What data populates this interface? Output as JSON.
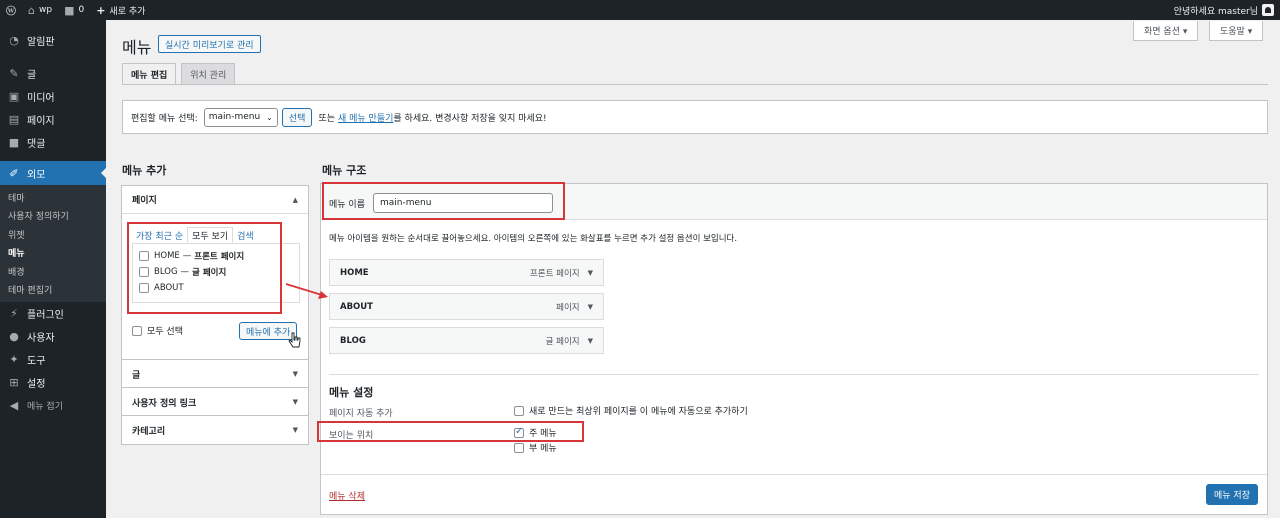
{
  "adminbar": {
    "site_name": "wp",
    "comments_count": "0",
    "new_label": "새로 추가",
    "greeting": "안녕하세요 master님"
  },
  "sidebar": {
    "items": [
      {
        "label": "알림판",
        "icon": "dashboard-icon"
      },
      {
        "label": "글",
        "icon": "pin-icon"
      },
      {
        "label": "미디어",
        "icon": "media-icon"
      },
      {
        "label": "페이지",
        "icon": "page-icon"
      },
      {
        "label": "댓글",
        "icon": "comment-icon"
      },
      {
        "label": "외모",
        "icon": "brush-icon"
      },
      {
        "label": "플러그인",
        "icon": "plugin-icon"
      },
      {
        "label": "사용자",
        "icon": "user-icon"
      },
      {
        "label": "도구",
        "icon": "wrench-icon"
      },
      {
        "label": "설정",
        "icon": "settings-icon"
      },
      {
        "label": "메뉴 접기",
        "icon": "collapse-icon"
      }
    ],
    "submenu": [
      "테마",
      "사용자 정의하기",
      "위젯",
      "메뉴",
      "배경",
      "테마 편집기"
    ]
  },
  "page": {
    "title": "메뉴",
    "live_preview_button": "실시간 미리보기로 관리",
    "screen_options": "화면 옵션 ▾",
    "help": "도움말 ▾",
    "tabs": [
      "메뉴 편집",
      "위치 관리"
    ]
  },
  "select_bar": {
    "label": "편집할 메뉴 선택:",
    "selected": "main-menu",
    "select_button": "선택",
    "or_text": "또는",
    "create_link": "새 메뉴 만들기",
    "suffix": "를 하세요. 변경사항 저장을 잊지 마세요!"
  },
  "add_menu": {
    "title": "메뉴 추가",
    "pages": {
      "header": "페이지",
      "tabs": [
        "가장 최근 순",
        "모두 보기",
        "검색"
      ],
      "items": [
        {
          "label": "HOME",
          "suffix": "프론트 페이지"
        },
        {
          "label": "BLOG",
          "suffix": "글 페이지"
        },
        {
          "label": "ABOUT",
          "suffix": ""
        }
      ],
      "select_all": "모두 선택",
      "add_button": "메뉴에 추가"
    },
    "sections": [
      "글",
      "사용자 정의 링크",
      "카테고리"
    ]
  },
  "structure": {
    "title": "메뉴 구조",
    "name_label": "메뉴 이름",
    "name_value": "main-menu",
    "instruction": "메뉴 아이템을 원하는 순서대로 끌어놓으세요. 아이템의 오른쪽에 있는 화살표를 누르면 추가 설정 옵션이 보입니다.",
    "items": [
      {
        "label": "HOME",
        "type": "프론트 페이지"
      },
      {
        "label": "ABOUT",
        "type": "페이지"
      },
      {
        "label": "BLOG",
        "type": "글 페이지"
      }
    ],
    "settings": {
      "title": "메뉴 설정",
      "auto_add_label": "페이지 자동 추가",
      "auto_add_option": "새로 만드는 최상위 페이지를 이 메뉴에 자동으로 추가하기",
      "location_label": "보이는 위치",
      "locations": [
        {
          "label": "주 메뉴",
          "checked": true
        },
        {
          "label": "부 메뉴",
          "checked": false
        }
      ]
    },
    "delete_link": "메뉴 삭제",
    "save_button": "메뉴 저장"
  },
  "colors": {
    "accent": "#2271b1",
    "highlight": "#d63638"
  }
}
